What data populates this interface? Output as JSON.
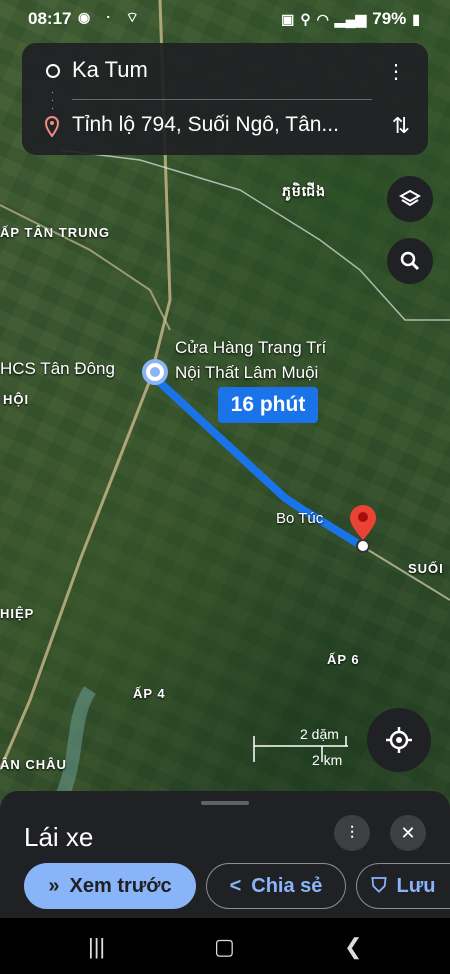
{
  "status_bar": {
    "time": "08:17",
    "battery": "79%"
  },
  "route": {
    "origin": "Ka Tum",
    "destination": "Tỉnh lộ 794, Suối Ngô, Tân..."
  },
  "map": {
    "labels": {
      "khmer": "ភូមិជើង",
      "ap_tan_trung": "ẤP TÂN TRUNG",
      "hoi": "HỘI",
      "hiep": "HIỆP",
      "ap_4": "ẤP 4",
      "ap_6": "ẤP 6",
      "an_chau": "ÂN CHÂU",
      "suoi": "SUỐI"
    },
    "poi": {
      "thcs": "HCS Tân Đông",
      "store_line1": "Cửa Hàng Trang Trí",
      "store_line2": "Nội Thất Lâm Muội",
      "bo_tuc": "Bo Túc"
    },
    "duration": "16 phút",
    "scale": {
      "miles": "2 dặm",
      "km": "2 km"
    },
    "route_color": "#1a73e8",
    "pin_color": "#ea4335"
  },
  "sheet": {
    "title": "Lái xe",
    "preview_label": "Xem trước",
    "share_label": "Chia sẻ",
    "save_label": "Lưu"
  },
  "icons": [
    "layers-icon",
    "search-icon",
    "recenter-icon",
    "filter-icon",
    "close-icon",
    "more-icon",
    "swap-icon",
    "share-icon",
    "bookmark-icon"
  ]
}
